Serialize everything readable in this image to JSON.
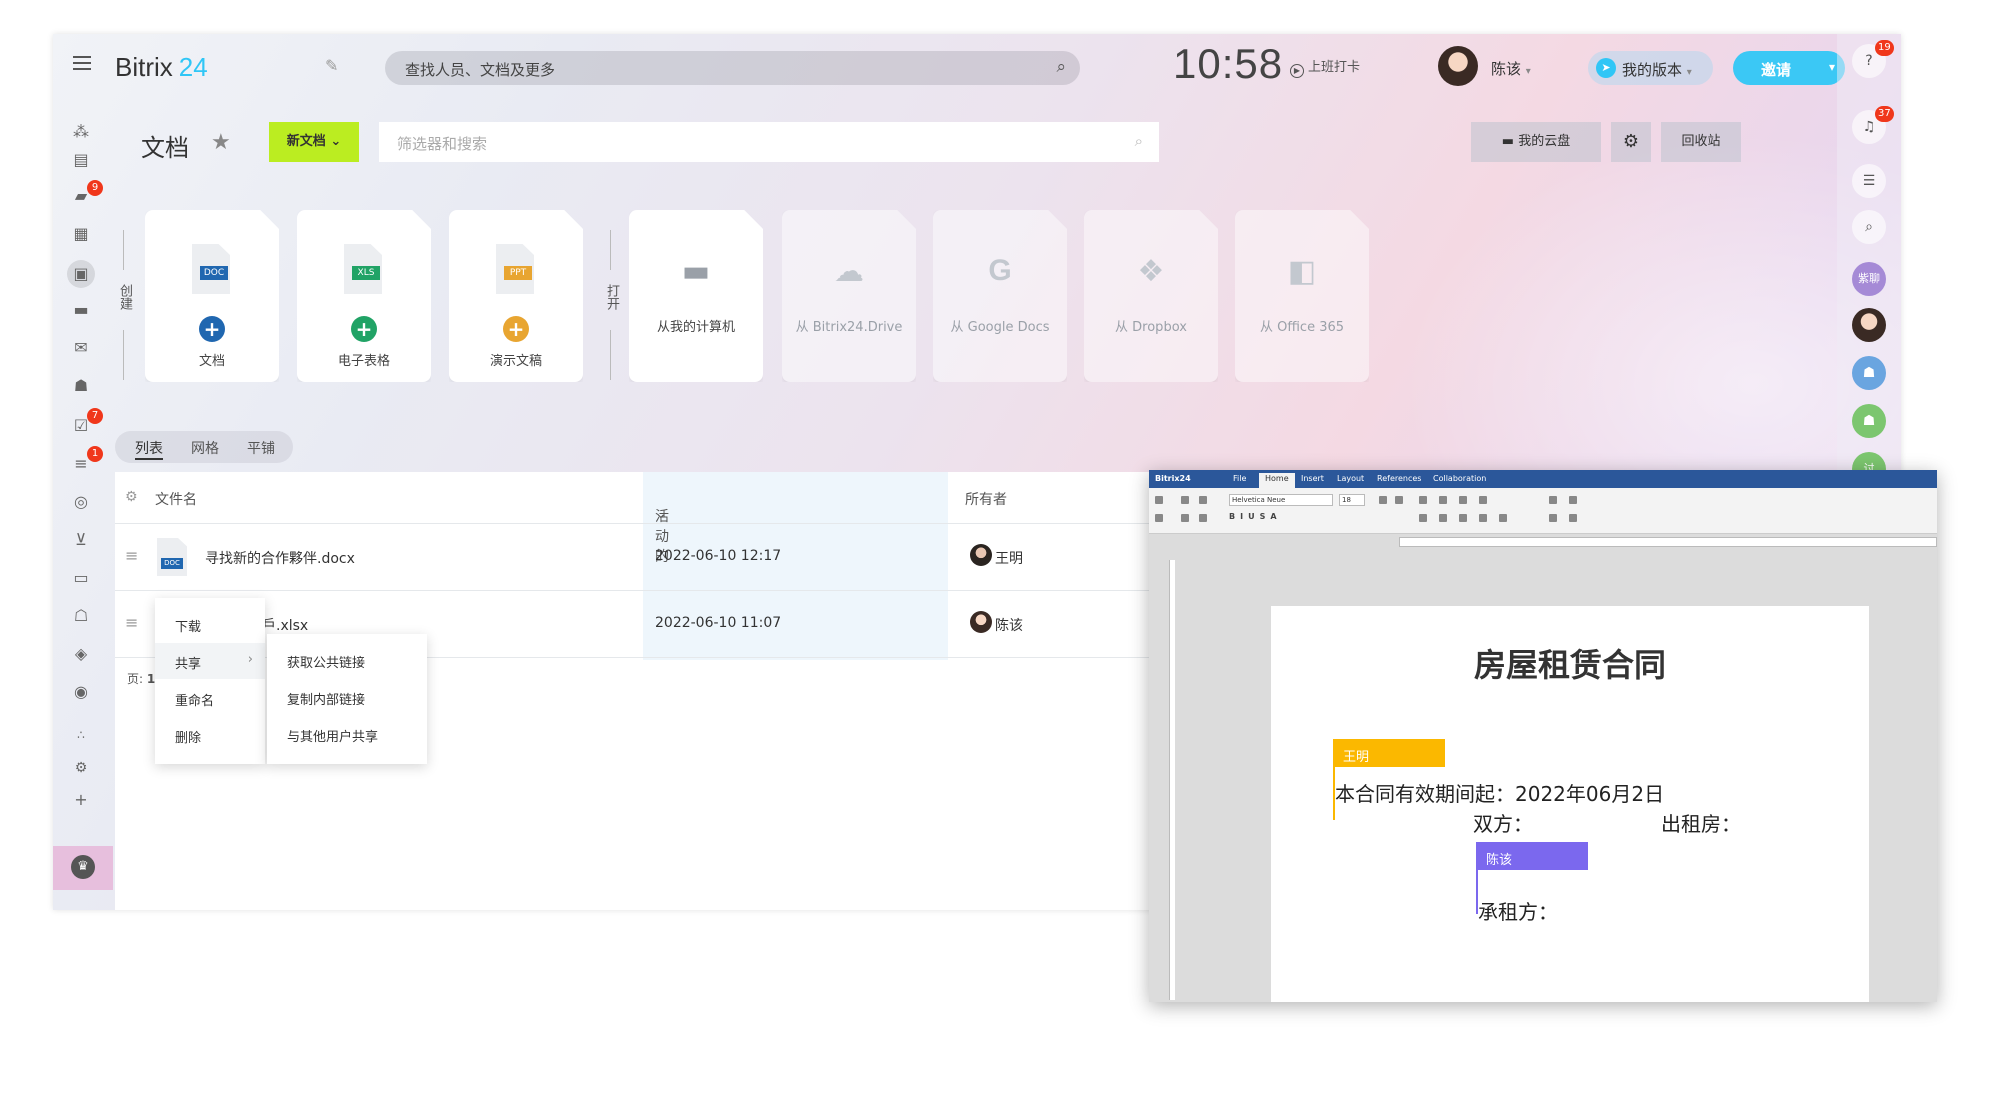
{
  "header": {
    "logo_name": "Bitrix",
    "logo_num": "24",
    "search_placeholder": "查找人员、文档及更多",
    "clock": "10:58",
    "checkin": "上班打卡",
    "user_name": "陈该",
    "version_label": "我的版本",
    "invite_label": "邀请"
  },
  "leftnav": {
    "badges": [
      "9",
      "7",
      "1"
    ]
  },
  "page": {
    "title": "文档",
    "new_doc_label": "新文档",
    "filter_placeholder": "筛选器和搜索",
    "my_drive": "我的云盘",
    "recycle": "回收站",
    "create_label": "创建",
    "open_label": "打开"
  },
  "create_tiles": [
    {
      "type": "DOC",
      "label": "文档",
      "color": "#2067b0"
    },
    {
      "type": "XLS",
      "label": "电子表格",
      "color": "#21a366"
    },
    {
      "type": "PPT",
      "label": "演示文稿",
      "color": "#e8a531"
    }
  ],
  "open_tiles": [
    {
      "label": "从我的计算机",
      "icon": "hard-drive-icon"
    },
    {
      "label": "从 Bitrix24.Drive",
      "icon": "cloud-upload-icon"
    },
    {
      "label": "从 Google Docs",
      "icon": "google-icon"
    },
    {
      "label": "从 Dropbox",
      "icon": "dropbox-icon"
    },
    {
      "label": "从 Office 365",
      "icon": "office-icon"
    }
  ],
  "view_tabs": [
    "列表",
    "网格",
    "平铺"
  ],
  "grid": {
    "col_name": "文件名",
    "col_activity": "活动的",
    "col_owner": "所有者",
    "rows": [
      {
        "name": "寻找新的合作夥伴.docx",
        "date": "2022-06-10 12:17",
        "owner": "王明"
      },
      {
        "name": "戶.xlsx",
        "date": "2022-06-10 11:07",
        "owner": "陈该"
      }
    ],
    "pager_prefix": "页:",
    "pager_num": "1"
  },
  "context_menu": [
    "下载",
    "共享",
    "重命名",
    "删除"
  ],
  "share_submenu": [
    "获取公共链接",
    "复制内部链接",
    "与其他用户共享"
  ],
  "rightbar": {
    "help_badge": "19",
    "notif_badge": "37",
    "chat_label": "紫聊",
    "last_label": "讨"
  },
  "word": {
    "app_label": "Bitrix24",
    "tabs": [
      "File",
      "Home",
      "Insert",
      "Layout",
      "References",
      "Collaboration"
    ],
    "font_name": "Helvetica Neue",
    "font_size": "18",
    "doc_title": "房屋租赁合同",
    "tag1": "王明",
    "tag1_color": "#fbb800",
    "line1": "本合同有效期间起：2022年06月2日",
    "line2a": "双方：",
    "line2b": "出租房：",
    "tag2": "陈该",
    "tag2_color": "#7b68ee",
    "line3": "承租方："
  }
}
